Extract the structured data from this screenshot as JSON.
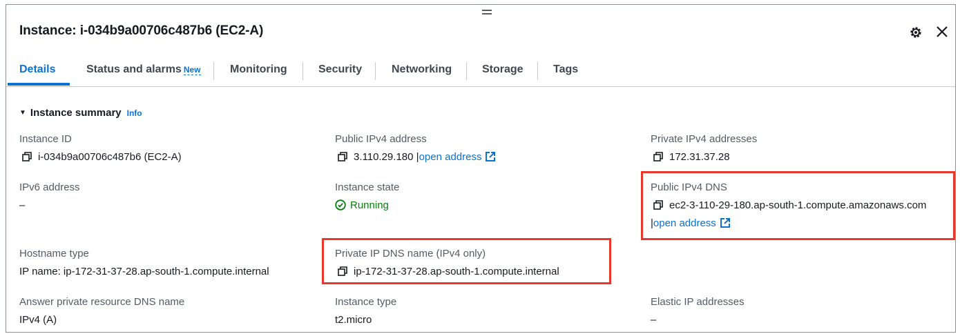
{
  "header": {
    "title": "Instance: i-034b9a00706c487b6 (EC2-A)"
  },
  "tabs": [
    {
      "label": "Details",
      "active": true
    },
    {
      "label": "Status and alarms",
      "badge": "New"
    },
    {
      "label": "Monitoring"
    },
    {
      "label": "Security"
    },
    {
      "label": "Networking"
    },
    {
      "label": "Storage"
    },
    {
      "label": "Tags"
    }
  ],
  "summary": {
    "heading": "Instance summary",
    "info_link": "Info"
  },
  "fields": {
    "instance_id": {
      "label": "Instance ID",
      "value": "i-034b9a00706c487b6 (EC2-A)"
    },
    "public_ipv4": {
      "label": "Public IPv4 address",
      "value": "3.110.29.180",
      "link": "open address"
    },
    "private_ipv4": {
      "label": "Private IPv4 addresses",
      "value": "172.31.37.28"
    },
    "ipv6": {
      "label": "IPv6 address",
      "value": "–"
    },
    "instance_state": {
      "label": "Instance state",
      "value": "Running"
    },
    "public_dns": {
      "label": "Public IPv4 DNS",
      "value": "ec2-3-110-29-180.ap-south-1.compute.amazonaws.com",
      "link": "open address"
    },
    "hostname_type": {
      "label": "Hostname type",
      "value": "IP name: ip-172-31-37-28.ap-south-1.compute.internal"
    },
    "private_dns": {
      "label": "Private IP DNS name (IPv4 only)",
      "value": "ip-172-31-37-28.ap-south-1.compute.internal"
    },
    "answer_dns": {
      "label": "Answer private resource DNS name",
      "value": "IPv4 (A)"
    },
    "instance_type": {
      "label": "Instance type",
      "value": "t2.micro"
    },
    "elastic_ip": {
      "label": "Elastic IP addresses",
      "value": "–"
    }
  },
  "colors": {
    "accent": "#0972d3",
    "running": "#037f0c",
    "highlight": "#e8372c"
  },
  "icons": [
    "drag-handle-icon",
    "gear-icon",
    "close-icon",
    "caret-down-icon",
    "copy-icon",
    "external-link-icon",
    "check-circle-icon"
  ]
}
